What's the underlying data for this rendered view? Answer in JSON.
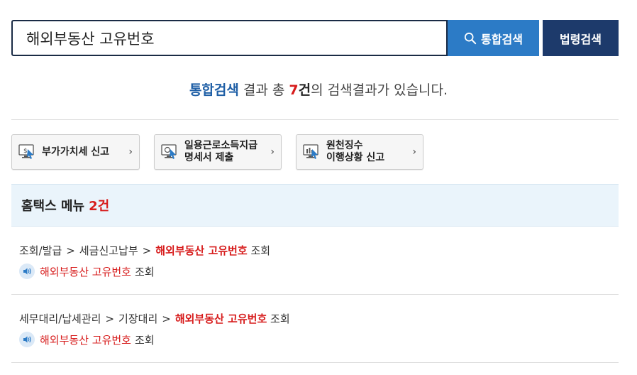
{
  "search": {
    "value": "해외부동산 고유번호",
    "total_button": "통합검색",
    "law_button": "법령검색"
  },
  "summary": {
    "scope": "통합검색",
    "text_before_count": " 결과 총 ",
    "count": "7",
    "count_unit": "건",
    "text_after": "의 검색결과가 있습니다."
  },
  "quick_links": [
    {
      "label_line1": "부가가치세 신고",
      "label_line2": "",
      "icon": "monitor-tax-icon"
    },
    {
      "label_line1": "일용근로소득지급",
      "label_line2": "명세서 제출",
      "icon": "monitor-doc-icon"
    },
    {
      "label_line1": "원천징수",
      "label_line2": "이행상황 신고",
      "icon": "monitor-chart-icon"
    }
  ],
  "menu_section": {
    "title": "홈택스 메뉴",
    "count": "2건"
  },
  "results": [
    {
      "path": [
        "조회/발급",
        "세금신고납부"
      ],
      "separator": ">",
      "highlight": "해외부동산 고유번호",
      "suffix": "조회",
      "sub_highlight": "해외부동산 고유번호",
      "sub_suffix": "조회"
    },
    {
      "path": [
        "세무대리/납세관리",
        "기장대리"
      ],
      "separator": ">",
      "highlight": "해외부동산 고유번호",
      "suffix": "조회",
      "sub_highlight": "해외부동산 고유번호",
      "sub_suffix": "조회"
    }
  ],
  "colors": {
    "search_border": "#1a2b45",
    "total_button_bg": "#2c7bc6",
    "law_button_bg": "#1d3a6b",
    "highlight_red": "#d71c1c",
    "scope_blue": "#1f5fa6",
    "menu_header_bg": "#eaf4fb"
  }
}
